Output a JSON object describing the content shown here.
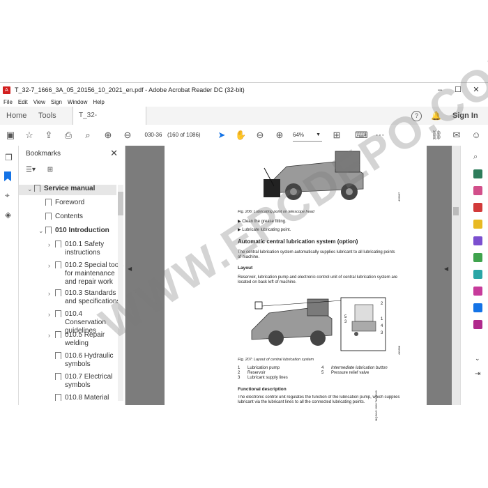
{
  "window": {
    "title": "T_32-7_1666_3A_05_20156_10_2021_en.pdf - Adobe Acrobat Reader DC (32-bit)",
    "controls": [
      "–",
      "☐",
      "✕"
    ]
  },
  "menu": [
    "File",
    "Edit",
    "View",
    "Sign",
    "Window",
    "Help"
  ],
  "tabs": {
    "home": "Home",
    "tools": "Tools",
    "doc": "T_32-7_1666_3A_0...",
    "doc_close": "✕",
    "sign_in": "Sign In"
  },
  "toolbar": {
    "page_value": "030-36",
    "page_count": "(160 of 1086)",
    "zoom": "64%"
  },
  "bookmarks": {
    "header": "Bookmarks",
    "close": "✕",
    "items": [
      {
        "label": "Service manual",
        "level": 0,
        "expanded": true,
        "selected": true
      },
      {
        "label": "Foreword",
        "level": 1
      },
      {
        "label": "Contents",
        "level": 1
      },
      {
        "label": "010 Introduction",
        "level": 1,
        "expanded": true
      },
      {
        "label": "010.1 Safety instructions",
        "level": 2,
        "collapsed": true
      },
      {
        "label": "010.2 Special tools for maintenance and repair work",
        "level": 2,
        "collapsed": true
      },
      {
        "label": "010.3 Standards and specifications",
        "level": 2,
        "collapsed": true
      },
      {
        "label": "010.4 Conservation guidelines",
        "level": 2,
        "collapsed": true
      },
      {
        "label": "010.5 Repair welding",
        "level": 2,
        "collapsed": true
      },
      {
        "label": "010.6 Hydraulic symbols",
        "level": 2
      },
      {
        "label": "010.7 Electrical symbols",
        "level": 2
      },
      {
        "label": "010.8 Material",
        "level": 2
      }
    ]
  },
  "page": {
    "fig206_caption": "Fig. 206: Lubricating point on telescope head",
    "fig206_code": "415897",
    "bullet1": "Clean the grease fitting.",
    "bullet2": "Lubricate lubricating point.",
    "section_title": "Automatic central lubrication system (option)",
    "para1": "The central lubrication system automatically supplies lubricant to all lubricating points of machine.",
    "layout_heading": "Layout",
    "para2": "Reservoir, lubrication pump and electronic control unit of central lubrication system are located on back left of machine.",
    "fig207_caption": "Fig. 207: Layout of central lubrication system",
    "fig207_code": "415898",
    "side_code": "MQS/AS 1000 TAA 2019",
    "legend": [
      {
        "num": "1",
        "text": "Lubrication pump"
      },
      {
        "num": "2",
        "text": "Reservoir"
      },
      {
        "num": "3",
        "text": "Lubricant supply lines"
      },
      {
        "num": "4",
        "text": "Intermediate lubrication button"
      },
      {
        "num": "5",
        "text": "Pressure relief valve"
      }
    ],
    "func_heading": "Functional description",
    "para3": "The electronic control unit regulates the function of the lubrication pump, which supplies lubricant via the lubricant lines to all the connected lubricating points.",
    "callouts": [
      "2",
      "5",
      "3",
      "1",
      "4",
      "3"
    ]
  },
  "watermark": "WWW.EPCDEPO.COM",
  "colors": {
    "accent": "#1473e6",
    "pdf_red": "#d21f1f",
    "doc_bg": "#7c7c7c"
  }
}
